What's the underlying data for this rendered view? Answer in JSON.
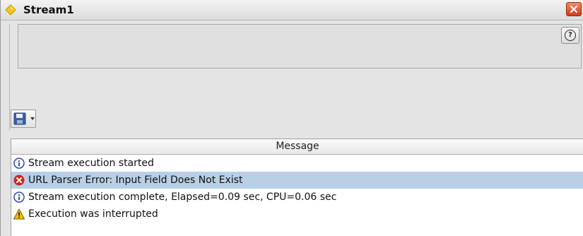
{
  "window": {
    "title": "Stream1",
    "close_icon": "close-icon",
    "title_icon": "stream-diamond-icon",
    "accent": "#f0c020"
  },
  "header": {
    "help_icon_glyph": "?"
  },
  "toolbar": {
    "save_icon": "floppy-disk-icon",
    "dropdown_icon": "chevron-down-icon"
  },
  "table": {
    "column_header": "Message",
    "rows": [
      {
        "icon": "info-icon",
        "text": "Stream execution started",
        "selected": false
      },
      {
        "icon": "error-icon",
        "text": "URL Parser Error: Input Field Does Not Exist",
        "selected": true
      },
      {
        "icon": "info-icon",
        "text": "Stream execution complete, Elapsed=0.09 sec, CPU=0.06 sec",
        "selected": false
      },
      {
        "icon": "warning-icon",
        "text": "Execution was interrupted",
        "selected": false
      }
    ]
  },
  "colors": {
    "selection": "#b8cfe6",
    "error": "#d0281c",
    "info": "#2a4fb0",
    "warning": "#f2c200"
  }
}
